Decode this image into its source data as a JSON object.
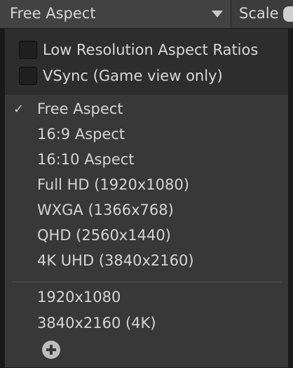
{
  "toolbar": {
    "aspect_selected": "Free Aspect",
    "scale_label": "Scale"
  },
  "menu": {
    "options": [
      {
        "label": "Low Resolution Aspect Ratios",
        "checked": false
      },
      {
        "label": "VSync (Game view only)",
        "checked": false
      }
    ],
    "check_mark": "✓",
    "builtin_aspects": [
      {
        "label": "Free Aspect",
        "selected": true
      },
      {
        "label": "16:9 Aspect",
        "selected": false
      },
      {
        "label": "16:10 Aspect",
        "selected": false
      },
      {
        "label": "Full HD (1920x1080)",
        "selected": false
      },
      {
        "label": "WXGA (1366x768)",
        "selected": false
      },
      {
        "label": "QHD (2560x1440)",
        "selected": false
      },
      {
        "label": "4K UHD (3840x2160)",
        "selected": false
      }
    ],
    "custom_aspects": [
      {
        "label": "1920x1080"
      },
      {
        "label": "3840x2160 (4K)"
      }
    ],
    "add_icon": "plus-circle-icon"
  }
}
